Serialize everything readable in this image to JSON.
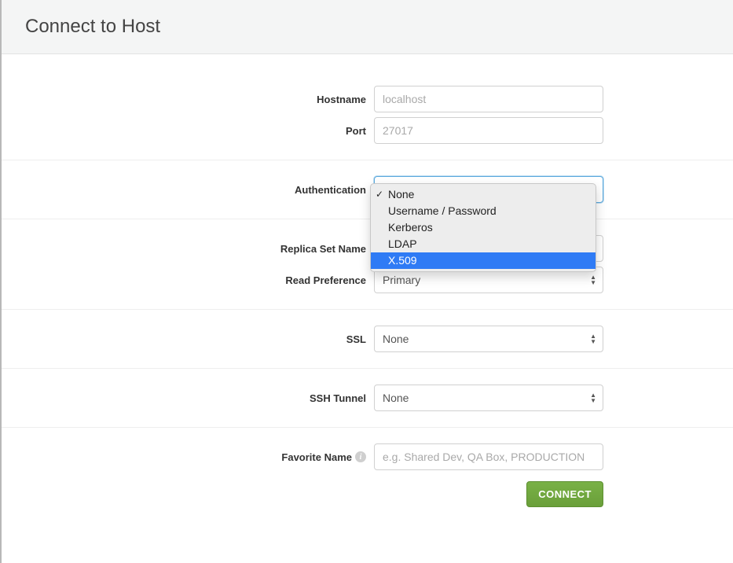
{
  "header": {
    "title": "Connect to Host"
  },
  "fields": {
    "hostname_label": "Hostname",
    "hostname_placeholder": "localhost",
    "hostname_value": "",
    "port_label": "Port",
    "port_placeholder": "27017",
    "port_value": "",
    "auth_label": "Authentication",
    "auth_selected": "None",
    "auth_options": [
      "None",
      "Username / Password",
      "Kerberos",
      "LDAP",
      "X.509"
    ],
    "auth_highlighted": "X.509",
    "replica_label": "Replica Set Name",
    "replica_value": "",
    "readpref_label": "Read Preference",
    "readpref_value": "Primary",
    "ssl_label": "SSL",
    "ssl_value": "None",
    "ssh_label": "SSH Tunnel",
    "ssh_value": "None",
    "fav_label": "Favorite Name",
    "fav_placeholder": "e.g. Shared Dev, QA Box, PRODUCTION",
    "fav_value": ""
  },
  "buttons": {
    "connect": "CONNECT"
  },
  "icons": {
    "info": "i"
  }
}
